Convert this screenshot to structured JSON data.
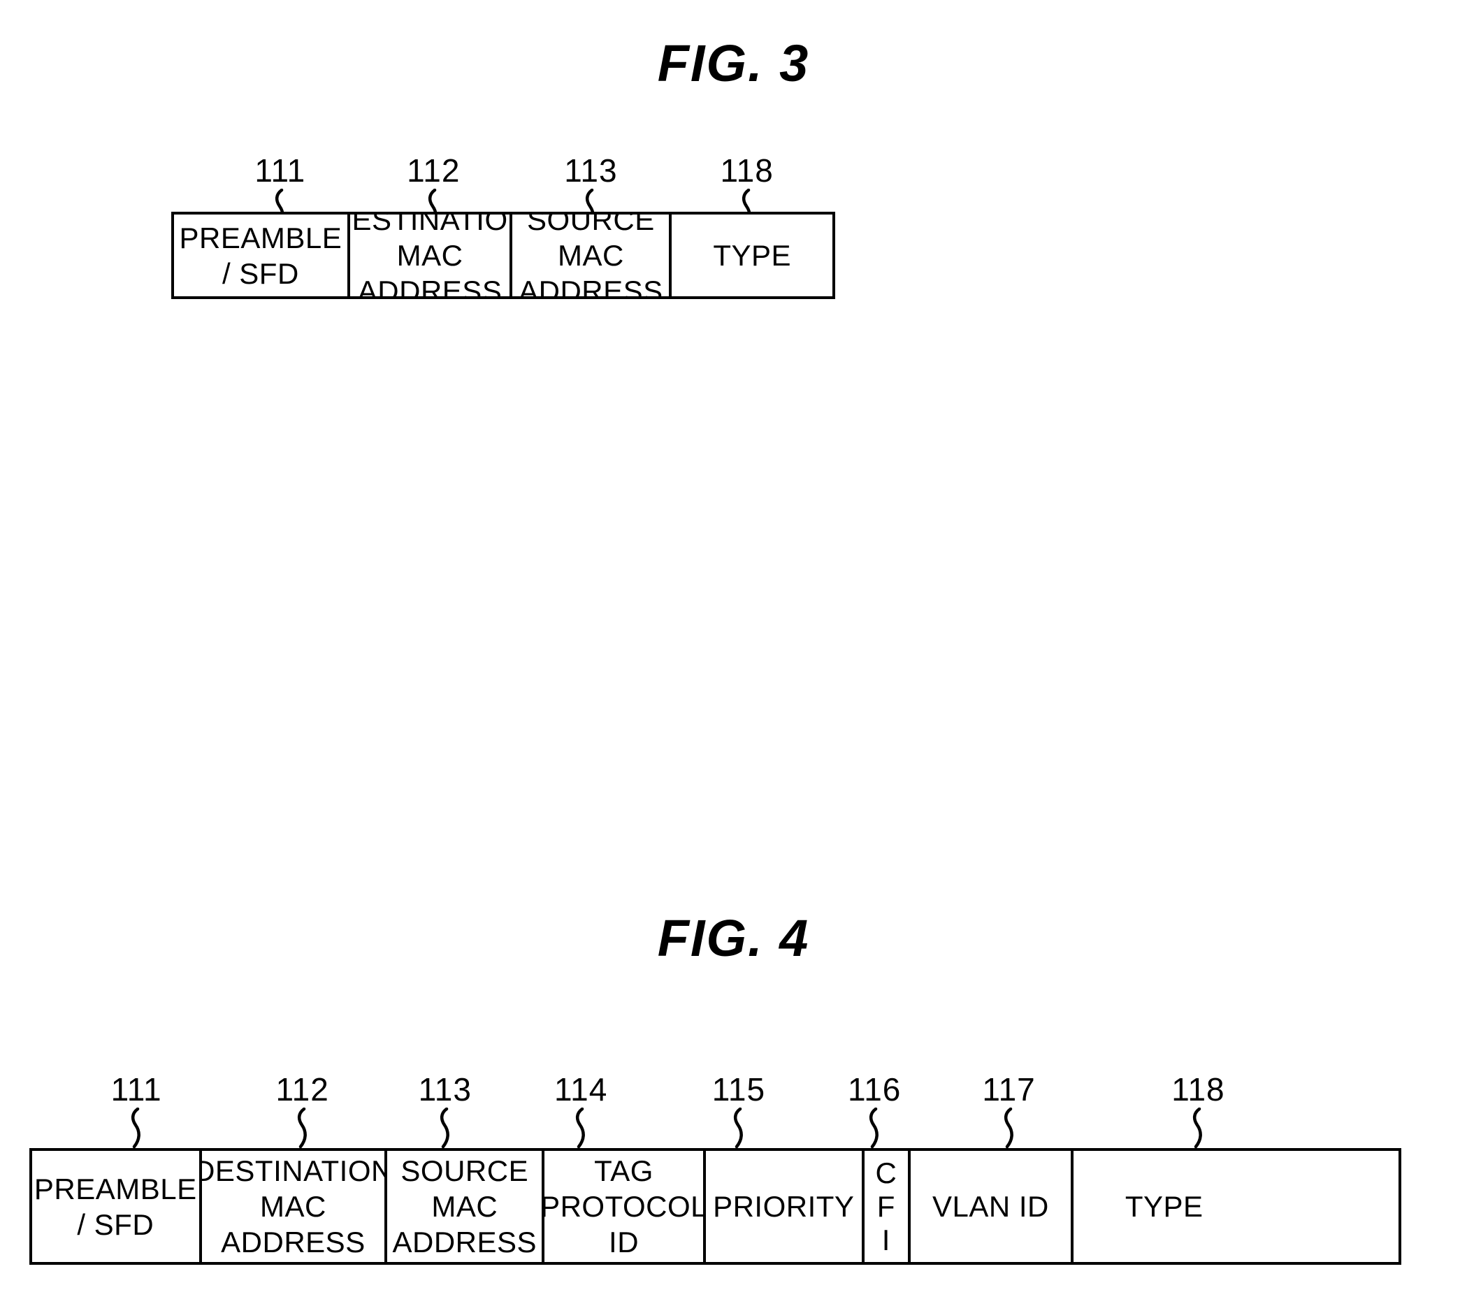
{
  "figures": [
    {
      "title": "FIG.  3",
      "refs": [
        {
          "number": "111",
          "x_pct": 16.4
        },
        {
          "number": "112",
          "x_pct": 39.5
        },
        {
          "number": "113",
          "x_pct": 63.2
        },
        {
          "number": "118",
          "x_pct": 86.7
        }
      ],
      "cells": [
        {
          "label": "PREAMBLE\n/ SFD",
          "width_pct": 26.3,
          "stacked": false
        },
        {
          "label": "DESTINATION\nMAC\nADDRESS",
          "width_pct": 24.7,
          "stacked": false
        },
        {
          "label": "SOURCE\nMAC\nADDRESS",
          "width_pct": 24.2,
          "stacked": false
        },
        {
          "label": "TYPE",
          "width_pct": 24.8,
          "stacked": false
        }
      ]
    },
    {
      "title": "FIG.  4",
      "refs": [
        {
          "number": "111",
          "x_pct": 7.8
        },
        {
          "number": "112",
          "x_pct": 19.9
        },
        {
          "number": "113",
          "x_pct": 30.3
        },
        {
          "number": "114",
          "x_pct": 40.2
        },
        {
          "number": "115",
          "x_pct": 51.7
        },
        {
          "number": "116",
          "x_pct": 61.6
        },
        {
          "number": "117",
          "x_pct": 71.4
        },
        {
          "number": "118",
          "x_pct": 85.2
        }
      ],
      "cells": [
        {
          "label": "PREAMBLE\n/ SFD",
          "width_pct": 12.2,
          "stacked": false
        },
        {
          "label": "DESTINATION\nMAC\nADDRESS",
          "width_pct": 13.6,
          "stacked": false
        },
        {
          "label": "SOURCE\nMAC\nADDRESS",
          "width_pct": 11.5,
          "stacked": false
        },
        {
          "label": "TAG\nPROTOCOL\nID",
          "width_pct": 11.8,
          "stacked": false
        },
        {
          "label": "PRIORITY",
          "width_pct": 11.6,
          "stacked": false
        },
        {
          "label": "C\nF\nI",
          "width_pct": 3.4,
          "stacked": true
        },
        {
          "label": "VLAN ID",
          "width_pct": 11.9,
          "stacked": false
        },
        {
          "label": "TYPE",
          "width_pct": 13.5,
          "stacked": false
        }
      ]
    }
  ],
  "colors": {
    "ink": "#000000",
    "paper": "#ffffff"
  }
}
